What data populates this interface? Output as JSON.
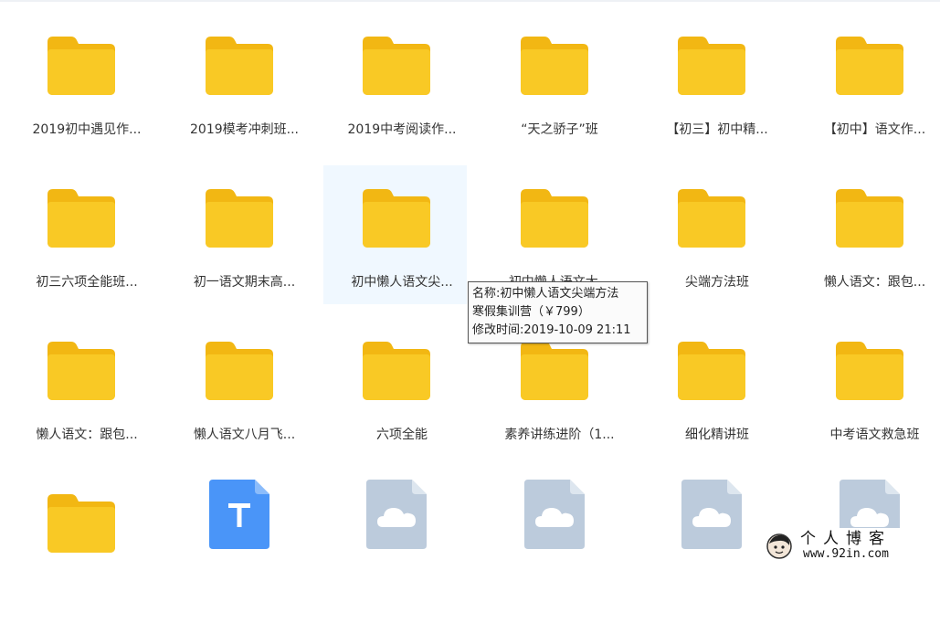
{
  "files": [
    {
      "name": "2019初中遇见作...",
      "type": "folder"
    },
    {
      "name": "2019模考冲刺班...",
      "type": "folder"
    },
    {
      "name": "2019中考阅读作...",
      "type": "folder"
    },
    {
      "name": "“天之骄子”班",
      "type": "folder"
    },
    {
      "name": "【初三】初中精...",
      "type": "folder"
    },
    {
      "name": "【初中】语文作...",
      "type": "folder"
    },
    {
      "name": "初三六项全能班...",
      "type": "folder"
    },
    {
      "name": "初一语文期末高...",
      "type": "folder"
    },
    {
      "name": "初中懒人语文尖...",
      "type": "folder",
      "selected": true
    },
    {
      "name": "初中懒人语文大...",
      "type": "folder"
    },
    {
      "name": "尖端方法班",
      "type": "folder"
    },
    {
      "name": "懒人语文：跟包...",
      "type": "folder"
    },
    {
      "name": "懒人语文：跟包...",
      "type": "folder"
    },
    {
      "name": "懒人语文八月飞...",
      "type": "folder"
    },
    {
      "name": "六项全能",
      "type": "folder"
    },
    {
      "name": "素养讲练进阶（1...",
      "type": "folder"
    },
    {
      "name": "细化精讲班",
      "type": "folder"
    },
    {
      "name": "中考语文救急班",
      "type": "folder"
    },
    {
      "name": "",
      "type": "folder"
    },
    {
      "name": "",
      "type": "text-file"
    },
    {
      "name": "",
      "type": "cloud-file"
    },
    {
      "name": "",
      "type": "cloud-file"
    },
    {
      "name": "",
      "type": "cloud-file"
    },
    {
      "name": "",
      "type": "cloud-file"
    }
  ],
  "tooltip": {
    "line1": "名称:初中懒人语文尖端方法",
    "line2": "寒假集训营（￥799）",
    "line3": "修改时间:2019-10-09 21:11"
  },
  "watermark": {
    "title": "个人博客",
    "url": "www.92in.com"
  },
  "colors": {
    "folder": "#f9c925",
    "folder_tab": "#f2b713",
    "text_file": "#4a95f8",
    "cloud_file": "#bccbdc",
    "selected_bg": "#f0f8ff"
  }
}
